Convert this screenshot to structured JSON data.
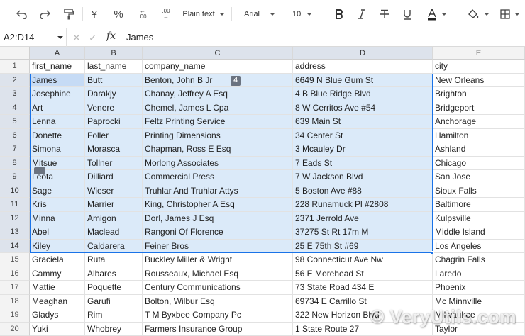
{
  "toolbar": {
    "format_label": "Plain text",
    "font_label": "Arial",
    "size_label": "10",
    "currency_symbol": "¥",
    "percent_symbol": "%",
    "dec_increase": ".00",
    "dec_decrease": ".00"
  },
  "formula_bar": {
    "name_box": "A2:D14",
    "fx": "fx",
    "value": "James"
  },
  "columns": [
    "A",
    "B",
    "C",
    "D",
    "E"
  ],
  "rows": [
    {
      "num": "1",
      "cells": [
        "first_name",
        "last_name",
        "company_name",
        "address",
        "city"
      ]
    },
    {
      "num": "2",
      "cells": [
        "James",
        "Butt",
        "Benton, John B Jr",
        "6649 N Blue Gum St",
        "New Orleans"
      ]
    },
    {
      "num": "3",
      "cells": [
        "Josephine",
        "Darakjy",
        "Chanay, Jeffrey A Esq",
        "4 B Blue Ridge Blvd",
        "Brighton"
      ]
    },
    {
      "num": "4",
      "cells": [
        "Art",
        "Venere",
        "Chemel, James L Cpa",
        "8 W Cerritos Ave #54",
        "Bridgeport"
      ]
    },
    {
      "num": "5",
      "cells": [
        "Lenna",
        "Paprocki",
        "Feltz Printing Service",
        "639 Main St",
        "Anchorage"
      ]
    },
    {
      "num": "6",
      "cells": [
        "Donette",
        "Foller",
        "Printing Dimensions",
        "34 Center St",
        "Hamilton"
      ]
    },
    {
      "num": "7",
      "cells": [
        "Simona",
        "Morasca",
        "Chapman, Ross E Esq",
        "3 Mcauley Dr",
        "Ashland"
      ]
    },
    {
      "num": "8",
      "cells": [
        "Mitsue",
        "Tollner",
        "Morlong Associates",
        "7 Eads St",
        "Chicago"
      ]
    },
    {
      "num": "9",
      "cells": [
        "Leota",
        "Dilliard",
        "Commercial Press",
        "7 W Jackson Blvd",
        "San Jose"
      ]
    },
    {
      "num": "10",
      "cells": [
        "Sage",
        "Wieser",
        "Truhlar And Truhlar Attys",
        "5 Boston Ave #88",
        "Sioux Falls"
      ]
    },
    {
      "num": "11",
      "cells": [
        "Kris",
        "Marrier",
        "King, Christopher A Esq",
        "228 Runamuck Pl #2808",
        "Baltimore"
      ]
    },
    {
      "num": "12",
      "cells": [
        "Minna",
        "Amigon",
        "Dorl, James J Esq",
        "2371 Jerrold Ave",
        "Kulpsville"
      ]
    },
    {
      "num": "13",
      "cells": [
        "Abel",
        "Maclead",
        "Rangoni Of Florence",
        "37275 St  Rt 17m M",
        "Middle Island"
      ]
    },
    {
      "num": "14",
      "cells": [
        "Kiley",
        "Caldarera",
        "Feiner Bros",
        "25 E 75th St #69",
        "Los Angeles"
      ]
    },
    {
      "num": "15",
      "cells": [
        "Graciela",
        "Ruta",
        "Buckley Miller & Wright",
        "98 Connecticut Ave Nw",
        "Chagrin Falls"
      ]
    },
    {
      "num": "16",
      "cells": [
        "Cammy",
        "Albares",
        "Rousseaux, Michael Esq",
        "56 E Morehead St",
        "Laredo"
      ]
    },
    {
      "num": "17",
      "cells": [
        "Mattie",
        "Poquette",
        "Century Communications",
        "73 State Road 434 E",
        "Phoenix"
      ]
    },
    {
      "num": "18",
      "cells": [
        "Meaghan",
        "Garufi",
        "Bolton, Wilbur Esq",
        "69734 E Carrillo St",
        "Mc Minnville"
      ]
    },
    {
      "num": "19",
      "cells": [
        "Gladys",
        "Rim",
        "T M Byxbee Company Pc",
        "322 New Horizon Blvd",
        "Milwaukee"
      ]
    },
    {
      "num": "20",
      "cells": [
        "Yuki",
        "Whobrey",
        "Farmers Insurance Group",
        "1 State Route 27",
        "Taylor"
      ]
    }
  ],
  "selection": {
    "count_badge": "4"
  },
  "watermark": "© VeryUtils.com",
  "colors": {
    "selection_border": "#1a73e8",
    "selection_fill": "#dbeaf9",
    "active_cell": "#c6dbf5"
  }
}
